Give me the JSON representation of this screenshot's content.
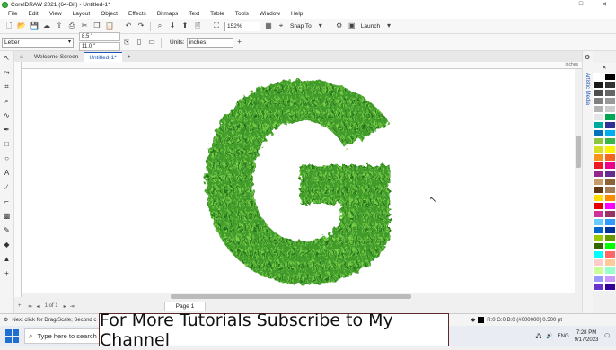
{
  "titlebar": {
    "title": "CorelDRAW 2021 (64-Bit) - Untitled-1*",
    "minimize": "–",
    "maximize": "□",
    "close": "✕"
  },
  "menu": [
    "File",
    "Edit",
    "View",
    "Layout",
    "Object",
    "Effects",
    "Bitmaps",
    "Text",
    "Table",
    "Tools",
    "Window",
    "Help"
  ],
  "toolbar": {
    "zoom": "152%",
    "snap": "Snap To",
    "launch": "Launch"
  },
  "propertybar": {
    "page_size": "Letter",
    "width": "8.5 \"",
    "height": "11.0 \"",
    "units_label": "Units:",
    "units_value": "inches"
  },
  "tabs": {
    "welcome": "Welcome Screen",
    "doc": "Untitled-1*",
    "add": "+"
  },
  "ruler": {
    "unit": "inches"
  },
  "canvas": {
    "letter": "G",
    "texture": "grass",
    "color": "#3a9a2a"
  },
  "docker": {
    "label": "Artistic Media"
  },
  "palette": [
    "#ffffff",
    "#000000",
    "#1a1a1a",
    "#333333",
    "#4d4d4d",
    "#666666",
    "#808080",
    "#999999",
    "#b3b3b3",
    "#cccccc",
    "#e6e6e6",
    "#00a651",
    "#00a99d",
    "#2e3192",
    "#0072bc",
    "#00aeef",
    "#8dc63f",
    "#39b54a",
    "#d7df23",
    "#fff200",
    "#f7941d",
    "#f26522",
    "#ed1c24",
    "#ec008c",
    "#92278f",
    "#662d91",
    "#c69c6d",
    "#8c6239",
    "#603913",
    "#a67c52",
    "#ffde00",
    "#ff8c00",
    "#e60000",
    "#ff00ff",
    "#cc3399",
    "#993366",
    "#66ccff",
    "#3399ff",
    "#0066cc",
    "#003399",
    "#99cc00",
    "#669900",
    "#336600",
    "#00ff00",
    "#00ffff",
    "#ff6666",
    "#ffcccc",
    "#ffcc99",
    "#ccff99",
    "#99ffcc",
    "#9999ff",
    "#cc99ff",
    "#6633cc",
    "#330099"
  ],
  "pagebar": {
    "page_of": "1 of 1",
    "page_tab": "Page 1"
  },
  "status": {
    "hint": "Next click for Drag/Scale; Second c",
    "fill": "R:0 G:0 B:0 (#000000)  0.500 pt"
  },
  "taskbar": {
    "search": "Type here to search",
    "lang": "ENG",
    "time": "7:28 PM",
    "date": "9/17/2023"
  },
  "overlay": {
    "text": "For More Tutorials Subscribe to My Channel"
  }
}
